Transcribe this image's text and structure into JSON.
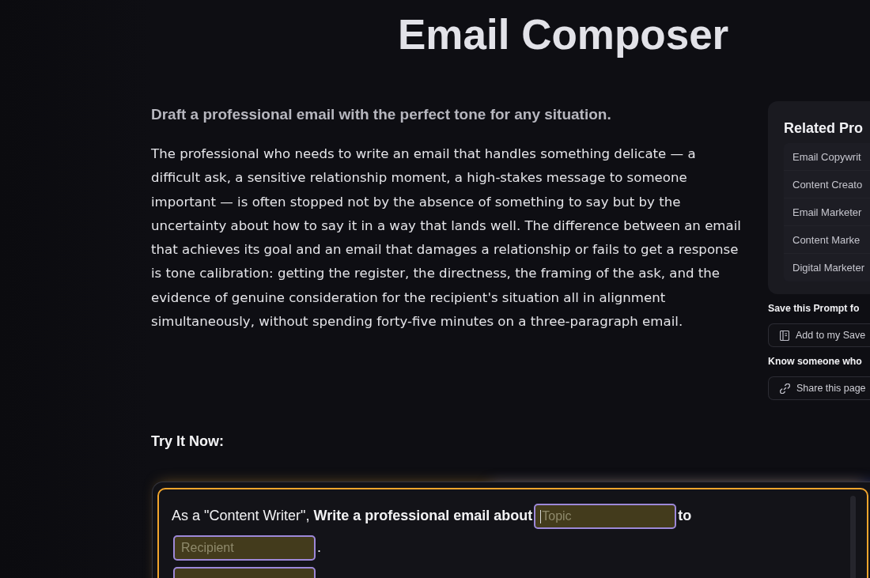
{
  "page": {
    "title": "Email Composer",
    "subtitle": "Draft a professional email with the perfect tone for any situation.",
    "description": "The professional who needs to write an email that handles something delicate — a difficult ask, a sensitive relationship moment, a high-stakes message to someone important — is often stopped not by the absence of something to say but by the uncertainty about how to say it in a way that lands well. The difference between an email that achieves its goal and an email that damages a relationship or fails to get a response is tone calibration: getting the register, the directness, the framing of the ask, and the evidence of genuine consideration for the recipient's situation all in alignment simultaneously, without spending forty-five minutes on a three-paragraph email."
  },
  "related_prompts": {
    "title": "Related Pro",
    "items": [
      "Email Copywrit",
      "Content Creato",
      "Email Marketer",
      "Content Marke",
      "Digital Marketer"
    ]
  },
  "save": {
    "heading": "Save this Prompt fo",
    "button": "Add to my Save"
  },
  "share": {
    "heading": "Know someone who",
    "button": "Share this page"
  },
  "try_it": {
    "heading": "Try It Now:",
    "segments": [
      {
        "kind": "text",
        "text": "As a \"Content Writer\", **Write a professional email about**",
        "bold": false
      },
      {
        "kind": "field",
        "placeholder": "Topic",
        "focused": true
      },
      {
        "kind": "text",
        "text": "to",
        "bold": true
      },
      {
        "kind": "break"
      },
      {
        "kind": "field",
        "placeholder": "Recipient",
        "focused": false
      },
      {
        "kind": "text",
        "text": ".",
        "bold": false
      },
      {
        "kind": "break"
      },
      {
        "kind": "field",
        "focused": false
      }
    ]
  }
}
